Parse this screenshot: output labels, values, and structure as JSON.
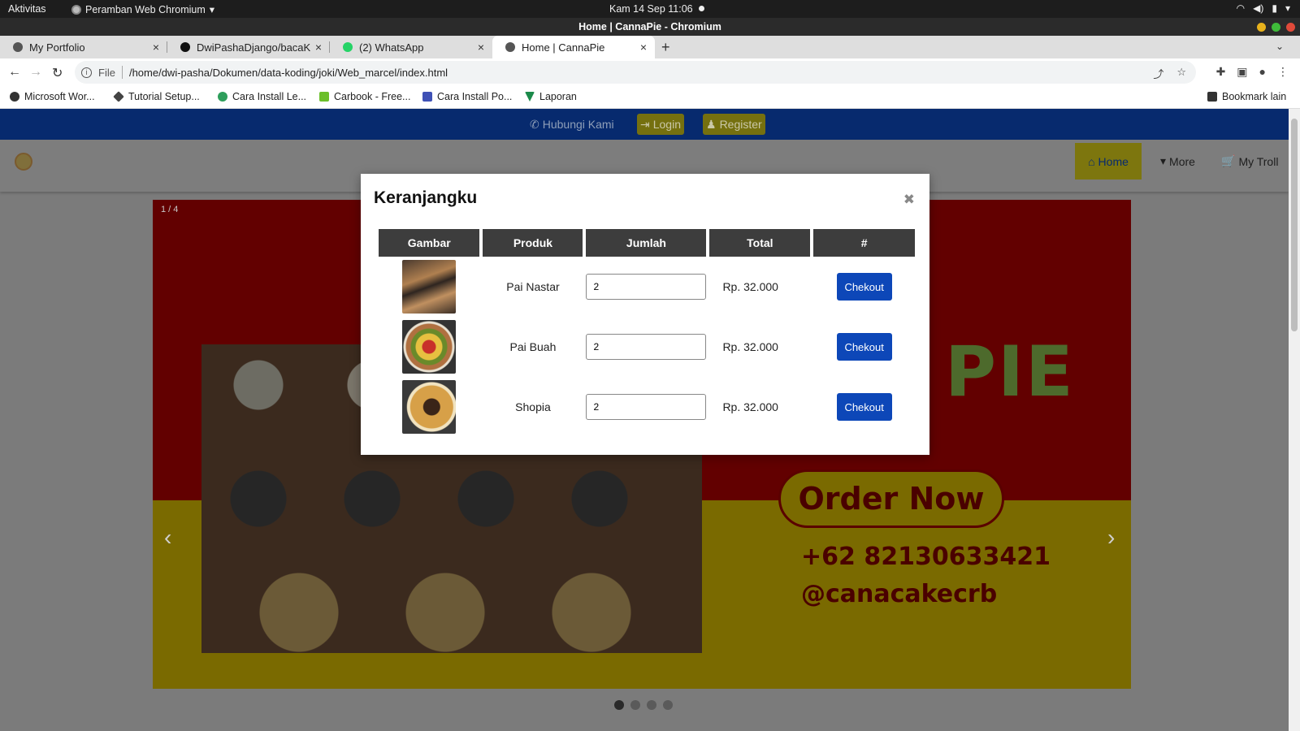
{
  "os": {
    "activities": "Aktivitas",
    "app_menu": "Peramban Web Chromium",
    "clock": "Kam 14 Sep  11:06"
  },
  "window": {
    "title": "Home | CannaPie - Chromium"
  },
  "tabs": [
    {
      "label": "My Portfolio",
      "favicon_color": "#555555"
    },
    {
      "label": "DwiPashaDjango/bacaKu",
      "favicon_color": "#111111"
    },
    {
      "label": "(2) WhatsApp",
      "favicon_color": "#25d366"
    },
    {
      "label": "Home | CannaPie",
      "favicon_color": "#555555"
    }
  ],
  "toolbar": {
    "scheme_label": "File",
    "url": "/home/dwi-pasha/Dokumen/data-koding/joki/Web_marcel/index.html"
  },
  "bookmarks": [
    {
      "label": "Microsoft Wor...",
      "color": "#333333"
    },
    {
      "label": "Tutorial Setup...",
      "color": "#444444"
    },
    {
      "label": "Cara Install Le...",
      "color": "#2e9e5b"
    },
    {
      "label": "Carbook - Free...",
      "color": "#6bbf2a"
    },
    {
      "label": "Cara Install Po...",
      "color": "#3f51b5"
    },
    {
      "label": "Laporan",
      "color": "#1b8a4a"
    }
  ],
  "bookmarks_other": "Bookmark lain",
  "site": {
    "topbar": {
      "contact": "Hubungi Kami",
      "login": "Login",
      "register": "Register"
    },
    "nav": {
      "home": "Home",
      "more": "More",
      "cart": "My Troll"
    },
    "hero": {
      "counter": "1 / 4",
      "brand_word": "PIE",
      "cta": "Order Now",
      "phone": "+62 82130633421",
      "instagram": "@canacakecrb",
      "slide_count": 4,
      "active_slide": 1
    }
  },
  "modal": {
    "title": "Keranjangku",
    "columns": [
      "Gambar",
      "Produk",
      "Jumlah",
      "Total",
      "#"
    ],
    "rows": [
      {
        "product": "Pai Nastar",
        "qty": "2",
        "total": "Rp. 32.000",
        "action": "Chekout"
      },
      {
        "product": "Pai Buah",
        "qty": "2",
        "total": "Rp. 32.000",
        "action": "Chekout"
      },
      {
        "product": "Shopia",
        "qty": "2",
        "total": "Rp. 32.000",
        "action": "Chekout"
      }
    ]
  },
  "colors": {
    "site_blue": "#0d47b8",
    "accent_yellow": "#f5d21a",
    "hero_red": "#c00000",
    "hero_yellow": "#f0d000"
  }
}
